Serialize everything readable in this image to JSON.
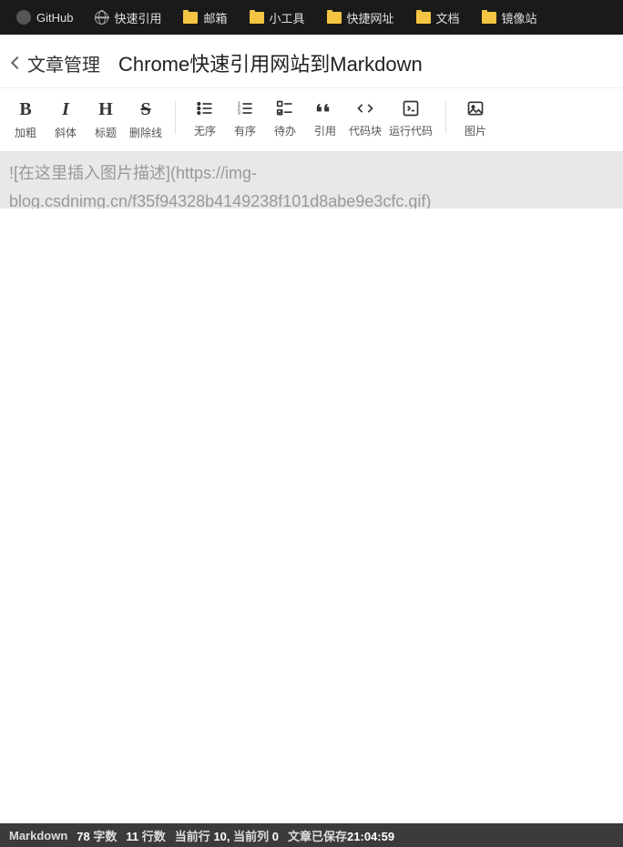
{
  "bookmarks": [
    {
      "label": "GitHub",
      "icon": "github"
    },
    {
      "label": "快速引用",
      "icon": "globe"
    },
    {
      "label": "邮箱",
      "icon": "folder"
    },
    {
      "label": "小工具",
      "icon": "folder"
    },
    {
      "label": "快捷网址",
      "icon": "folder"
    },
    {
      "label": "文档",
      "icon": "folder"
    },
    {
      "label": "镜像站",
      "icon": "folder"
    }
  ],
  "header": {
    "back_label": "文章管理",
    "title_value": "Chrome快速引用网站到Markdown"
  },
  "toolbar": {
    "groups": [
      [
        {
          "name": "bold-button",
          "icon": "B",
          "iconClass": "",
          "label": "加粗"
        },
        {
          "name": "italic-button",
          "icon": "I",
          "iconClass": "italic",
          "label": "斜体"
        },
        {
          "name": "heading-button",
          "icon": "H",
          "iconClass": "",
          "label": "标题"
        },
        {
          "name": "strike-button",
          "icon": "S",
          "iconClass": "strike",
          "label": "删除线"
        }
      ],
      [
        {
          "name": "ul-button",
          "icon": "svg-ul",
          "label": "无序"
        },
        {
          "name": "ol-button",
          "icon": "svg-ol",
          "label": "有序"
        },
        {
          "name": "todo-button",
          "icon": "svg-todo",
          "label": "待办"
        },
        {
          "name": "quote-button",
          "icon": "svg-quote",
          "label": "引用"
        },
        {
          "name": "codeblock-button",
          "icon": "svg-code",
          "label": "代码块"
        },
        {
          "name": "runcode-button",
          "icon": "svg-run",
          "label": "运行代码"
        }
      ],
      [
        {
          "name": "image-button",
          "icon": "svg-image",
          "label": "图片"
        }
      ]
    ]
  },
  "editor": {
    "placeholder_line1": "![在这里插入图片描述](https://img-",
    "placeholder_line2": "blog.csdnimg.cn/f35f94328b4149238f101d8abe9e3cfc.gif)"
  },
  "status": {
    "mode": "Markdown",
    "word_count_num": "78",
    "word_count_label": "字数",
    "line_count_num": "11",
    "line_count_label": "行数",
    "current_line_label": "当前行",
    "current_line_num": "10,",
    "current_col_label": "当前列",
    "current_col_num": "0",
    "saved_label": "文章已保存",
    "saved_time": "21:04:59"
  }
}
